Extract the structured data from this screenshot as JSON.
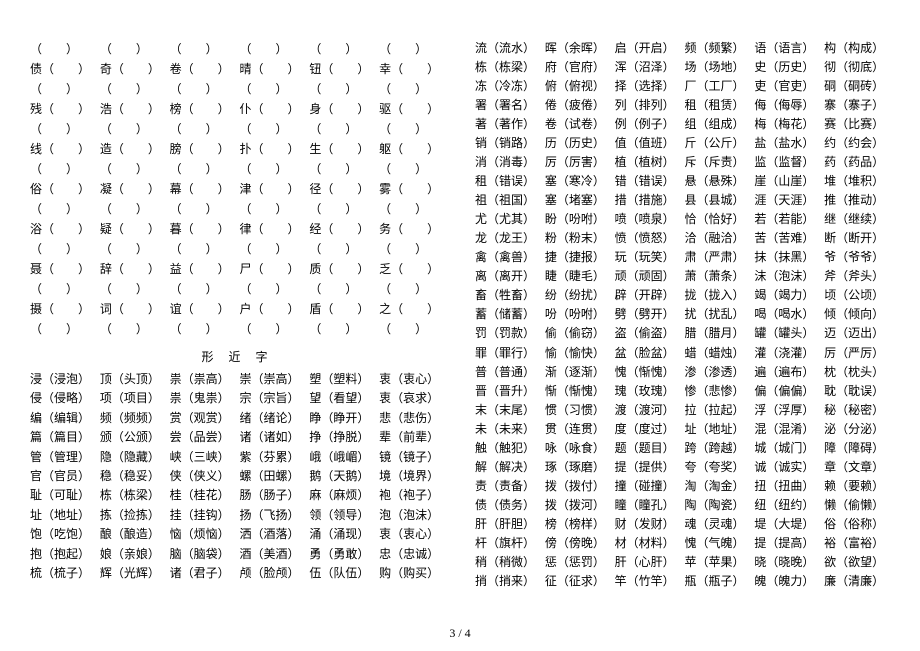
{
  "page_number": "3 / 4",
  "section_title": "形 近 字",
  "blank_rows": [
    [
      "",
      "",
      "",
      "",
      "",
      ""
    ],
    [
      "债",
      "奇",
      "卷",
      "晴",
      "钮",
      "幸"
    ],
    [
      "残",
      "浩",
      "榜",
      "仆",
      "身",
      "驱"
    ],
    [
      "线",
      "造",
      "膀",
      "扑",
      "生",
      "躯"
    ],
    [
      "俗",
      "凝",
      "幕",
      "津",
      "径",
      "雾"
    ],
    [
      "浴",
      "疑",
      "暮",
      "律",
      "经",
      "务"
    ],
    [
      "聂",
      "辞",
      "益",
      "尸",
      "质",
      "乏"
    ],
    [
      "摄",
      "词",
      "谊",
      "户",
      "盾",
      "之"
    ]
  ],
  "left_words": [
    [
      "浸（浸泡）",
      "顶（头顶）",
      "祟（祟高）",
      "崇（崇高）",
      "塑（塑料）",
      "衷（衷心）"
    ],
    [
      "侵（侵略）",
      "项（项目）",
      "祟（鬼祟）",
      "宗（宗旨）",
      "望（看望）",
      "衷（哀求）"
    ],
    [
      "编（编辑）",
      "频（频频）",
      "赏（观赏）",
      "绪（绪论）",
      "睁（睁开）",
      "悲（悲伤）"
    ],
    [
      "篇（篇目）",
      "颁（公颁）",
      "尝（品尝）",
      "诸（诸如）",
      "挣（挣脱）",
      "辈（前辈）"
    ],
    [
      "管（管理）",
      "隐（隐藏）",
      "峡（三峡）",
      "紫（芬累）",
      "峨（峨嵋）",
      "镜（镜子）"
    ],
    [
      "官（官员）",
      "稳（稳妥）",
      "侠（侠义）",
      "螺（田螺）",
      "鹅（天鹅）",
      "境（境界）"
    ],
    [
      "耻（可耻）",
      "栋（栋梁）",
      "桂（桂花）",
      "肠（肠子）",
      "麻（麻烦）",
      "袍（袍子）"
    ],
    [
      "址（地址）",
      "拣（捡拣）",
      "挂（挂钩）",
      "扬（飞扬）",
      "领（领导）",
      "泡（泡沫）"
    ],
    [
      "饱（吃饱）",
      "酿（酿造）",
      "恼（烦恼）",
      "洒（酒落）",
      "涌（涌现）",
      "衷（衷心）"
    ],
    [
      "抱（抱起）",
      "娘（亲娘）",
      "脑（脑袋）",
      "酒（美酒）",
      "勇（勇敢）",
      "忠（忠诚）"
    ],
    [
      "梳（梳子）",
      "辉（光辉）",
      "诸（君子）",
      "颅（脸颅）",
      "伍（队伍）",
      "购（购买）"
    ]
  ],
  "right_words": [
    [
      "流（流水）",
      "晖（余晖）",
      "启（开启）",
      "频（频繁）",
      "语（语言）",
      "构（构成）"
    ],
    [
      "栋（栋梁）",
      "府（官府）",
      "浑（沼泽）",
      "场（场地）",
      "史（历史）",
      "彻（彻底）"
    ],
    [
      "冻（冷冻）",
      "俯（俯视）",
      "择（选择）",
      "厂（工厂）",
      "吏（官吏）",
      "硐（硐砖）"
    ],
    [
      "署（署名）",
      "倦（疲倦）",
      "列（排列）",
      "租（租赁）",
      "侮（侮辱）",
      "寨（寨子）"
    ],
    [
      "著（著作）",
      "卷（试卷）",
      "例（例子）",
      "组（组成）",
      "梅（梅花）",
      "赛（比赛）"
    ],
    [
      "销（销路）",
      "历（历史）",
      "值（值班）",
      "斤（公斤）",
      "盐（盐水）",
      "约（约会）"
    ],
    [
      "消（消毒）",
      "厉（厉害）",
      "植（植树）",
      "斥（斥责）",
      "监（监督）",
      "药（药品）"
    ],
    [
      "租（错误）",
      "塞（寒冷）",
      "错（错误）",
      "悬（悬殊）",
      "崖（山崖）",
      "堆（堆积）"
    ],
    [
      "祖（祖国）",
      "塞（堵塞）",
      "措（措施）",
      "县（县城）",
      "涯（天涯）",
      "推（推动）"
    ],
    [
      "尤（尤其）",
      "盼（吩咐）",
      "喷（喷泉）",
      "恰（恰好）",
      "若（若能）",
      "继（继续）"
    ],
    [
      "龙（龙王）",
      "粉（粉末）",
      "愤（愤怒）",
      "洽（融洽）",
      "苦（苦难）",
      "断（断开）"
    ],
    [
      "禽（禽兽）",
      "捷（捷报）",
      "玩（玩笑）",
      "肃（严肃）",
      "抹（抹黑）",
      "爷（爷爷）"
    ],
    [
      "离（离开）",
      "睫（睫毛）",
      "顽（顽固）",
      "萧（萧条）",
      "沫（泡沫）",
      "斧（斧头）"
    ],
    [
      "畜（牲畜）",
      "纷（纷扰）",
      "辟（开辟）",
      "拢（拢入）",
      "竭（竭力）",
      "顷（公顷）"
    ],
    [
      "蓄（储蓄）",
      "吩（吩咐）",
      "劈（劈开）",
      "扰（扰乱）",
      "喝（喝水）",
      "倾（倾向）"
    ],
    [
      "罚（罚款）",
      "偷（偷窃）",
      "盗（偷盗）",
      "腊（腊月）",
      "罐（罐头）",
      "迈（迈出）"
    ],
    [
      "罪（罪行）",
      "愉（愉快）",
      "盆（脸盆）",
      "蜡（蜡烛）",
      "灌（浇灌）",
      "厉（严厉）"
    ],
    [
      "普（普通）",
      "渐（逐渐）",
      "愧（惭愧）",
      "渗（渗透）",
      "遍（遍布）",
      "枕（枕头）"
    ],
    [
      "晋（晋升）",
      "惭（惭愧）",
      "瑰（玫瑰）",
      "惨（悲惨）",
      "偏（偏偏）",
      "耽（耽误）"
    ],
    [
      "末（末尾）",
      "惯（习惯）",
      "渡（渡河）",
      "拉（拉起）",
      "浮（浮厚）",
      "秘（秘密）"
    ],
    [
      "未（未来）",
      "贯（连贯）",
      "度（度过）",
      "址（地址）",
      "混（混淆）",
      "泌（分泌）"
    ],
    [
      "触（触犯）",
      "咏（咏食）",
      "题（题目）",
      "跨（跨越）",
      "城（城门）",
      "障（障碍）"
    ],
    [
      "解（解决）",
      "琢（琢磨）",
      "提（提供）",
      "夸（夸奖）",
      "诚（诚实）",
      "章（文章）"
    ],
    [
      "责（责备）",
      "拨（拨付）",
      "撞（碰撞）",
      "淘（淘金）",
      "扭（扭曲）",
      "赖（要赖）"
    ],
    [
      "债（债务）",
      "拨（拨河）",
      "瞳（瞳孔）",
      "陶（陶瓷）",
      "纽（纽约）",
      "懒（偷懒）"
    ],
    [
      "肝（肝胆）",
      "榜（榜样）",
      "财（发财）",
      "魂（灵魂）",
      "堤（大堤）",
      "俗（俗称）"
    ],
    [
      "杆（旗杆）",
      "傍（傍晚）",
      "材（材料）",
      "愧（气魄）",
      "提（提高）",
      "裕（富裕）"
    ],
    [
      "稍（稍微）",
      "惩（惩罚）",
      "肝（心肝）",
      "苹（苹果）",
      "晓（晓晚）",
      "欲（欲望）"
    ],
    [
      "捎（捎来）",
      "征（征求）",
      "竿（竹竿）",
      "瓶（瓶子）",
      "魄（魄力）",
      "廉（清廉）"
    ]
  ]
}
